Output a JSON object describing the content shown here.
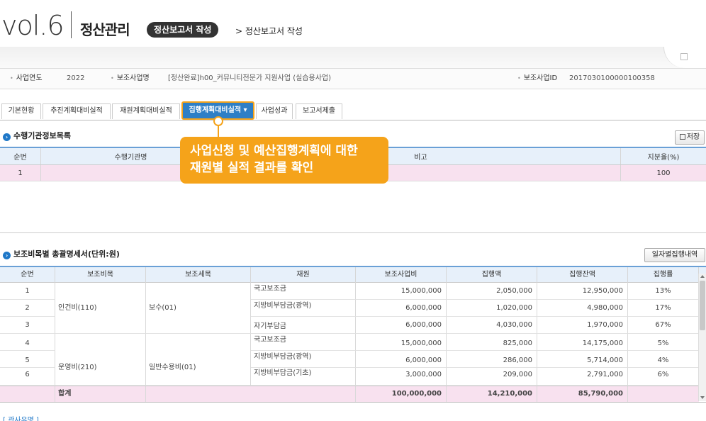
{
  "header": {
    "vol": "vol.6",
    "title": "정산관리",
    "pill": "정산보고서 작성",
    "breadcrumb": "> 정산보고서 작성"
  },
  "info": {
    "year_label": "사업연도",
    "year_value": "2022",
    "project_label": "보조사업명",
    "project_value": "[정산완료]h00_커뮤니티전문가 지원사업 (실습용사업)",
    "id_label": "보조사업ID",
    "id_value": "2017030100000100358"
  },
  "tabs": [
    {
      "label": "기본현황"
    },
    {
      "label": "추진계획대비실적"
    },
    {
      "label": "재원계획대비실적"
    },
    {
      "label": "집행계획대비실적 ▾"
    },
    {
      "label": "사업성과"
    },
    {
      "label": "보고서제출"
    }
  ],
  "section1": {
    "title": "수행기관정보목록",
    "save_button": "저장",
    "headers": {
      "no": "순번",
      "org": "수행기관명",
      "note": "비고",
      "ratio": "지분율(%)"
    },
    "rows": [
      {
        "no": "1",
        "ratio": "100"
      }
    ]
  },
  "callout": {
    "line1": "사업신청 및 예산집행계획에 대한",
    "line2": "재원별 실적 결과를 확인"
  },
  "section2": {
    "title": "보조비목별 총괄명세서(단위:원)",
    "button": "일자별집행내역",
    "headers": [
      "순번",
      "보조비목",
      "보조세목",
      "재원",
      "보조사업비",
      "집행액",
      "집행잔액",
      "집행률"
    ],
    "groups": [
      {
        "bimok": "인건비(110)",
        "semok": "보수(01)"
      },
      {
        "bimok": "운영비(210)",
        "semok": "일반수용비(01)"
      }
    ],
    "rows": [
      {
        "no": "1",
        "source": "국고보조금",
        "budget": "15,000,000",
        "spent": "2,050,000",
        "balance": "12,950,000",
        "rate": "13%"
      },
      {
        "no": "2",
        "source": "지방비부담금(광역)",
        "budget": "6,000,000",
        "spent": "1,020,000",
        "balance": "4,980,000",
        "rate": "17%"
      },
      {
        "no": "3",
        "source": "자기부담금",
        "budget": "6,000,000",
        "spent": "4,030,000",
        "balance": "1,970,000",
        "rate": "67%"
      },
      {
        "no": "4",
        "source": "국고보조금",
        "budget": "15,000,000",
        "spent": "825,000",
        "balance": "14,175,000",
        "rate": "5%"
      },
      {
        "no": "5",
        "source": "지방비부담금(광역)",
        "budget": "6,000,000",
        "spent": "286,000",
        "balance": "5,714,000",
        "rate": "4%"
      },
      {
        "no": "6",
        "source": "지방비부담금(기초)",
        "budget": "3,000,000",
        "spent": "209,000",
        "balance": "2,791,000",
        "rate": "6%"
      }
    ],
    "total": {
      "label": "합계",
      "budget": "100,000,000",
      "spent": "14,210,000",
      "balance": "85,790,000"
    }
  },
  "footer": {
    "text": "[ 관사유명 ]"
  }
}
